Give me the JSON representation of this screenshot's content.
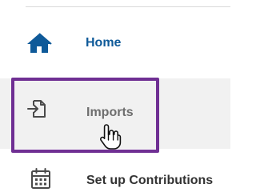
{
  "nav": {
    "items": [
      {
        "label": "Home",
        "icon": "home-icon",
        "color": "#0f5a99"
      },
      {
        "label": "Imports",
        "icon": "import-file-icon",
        "color": "#6e6e6e",
        "state": "hovered-focused"
      },
      {
        "label": "Set up Contributions",
        "icon": "calendar-icon",
        "color": "#333333"
      }
    ]
  },
  "colors": {
    "focus_outline": "#6f2f93",
    "hover_background": "#f1f1f1",
    "home_icon": "#0f5a99"
  }
}
